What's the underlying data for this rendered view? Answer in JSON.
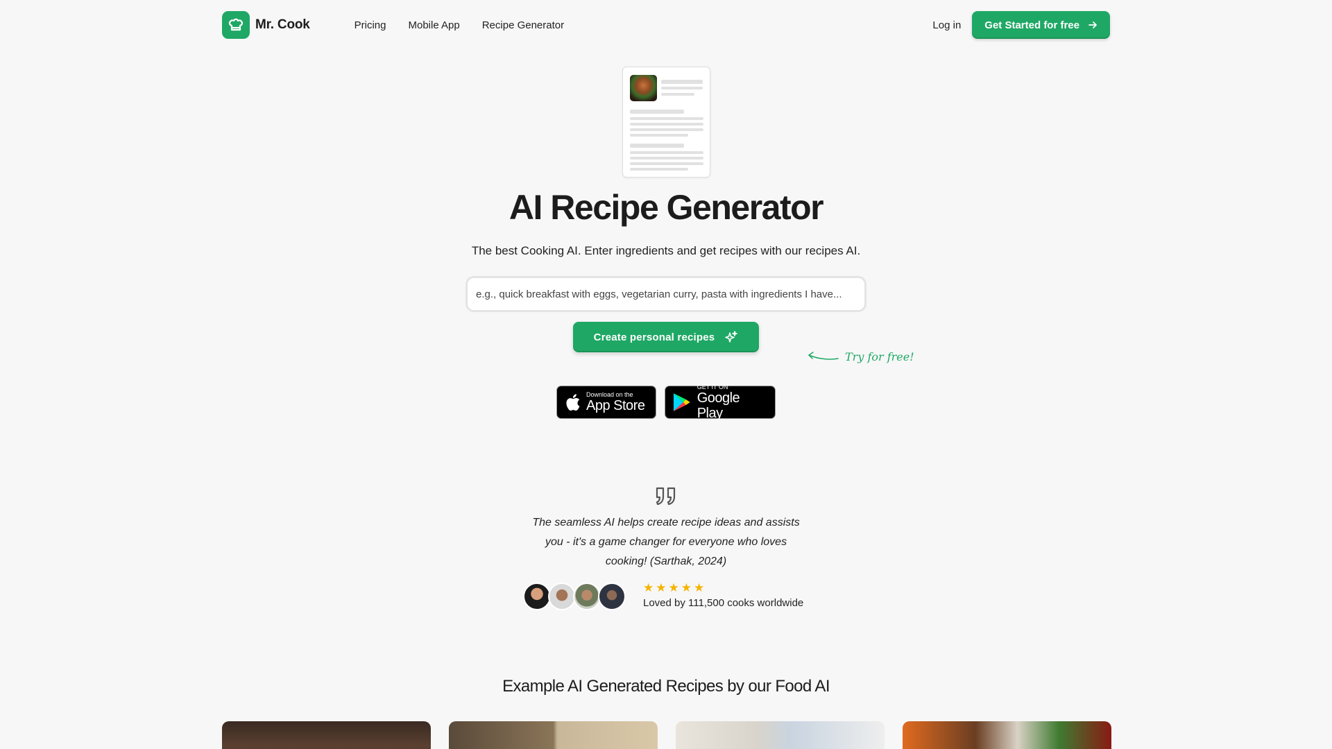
{
  "brand": {
    "name": "Mr. Cook",
    "color": "#1fa865"
  },
  "nav": {
    "links": [
      "Pricing",
      "Mobile App",
      "Recipe Generator"
    ],
    "login": "Log in",
    "cta": "Get Started for free"
  },
  "hero": {
    "title": "AI Recipe Generator",
    "subtitle": "The best Cooking AI. Enter ingredients and get recipes with our recipes AI.",
    "search_placeholder": "e.g., quick breakfast with eggs, vegetarian curry, pasta with ingredients I have...",
    "button": "Create personal recipes",
    "try_free": "Try for free!"
  },
  "stores": {
    "apple_small": "Download on the",
    "apple_big": "App Store",
    "google_small": "GET IT ON",
    "google_big": "Google Play"
  },
  "testimonial": {
    "quote": "The seamless AI helps create recipe ideas and assists you - it's a game changer for everyone who loves cooking! (Sarthak, 2024)",
    "rating": 5,
    "loved": "Loved by 111,500 cooks worldwide"
  },
  "examples": {
    "title": "Example AI Generated Recipes by our Food AI"
  }
}
